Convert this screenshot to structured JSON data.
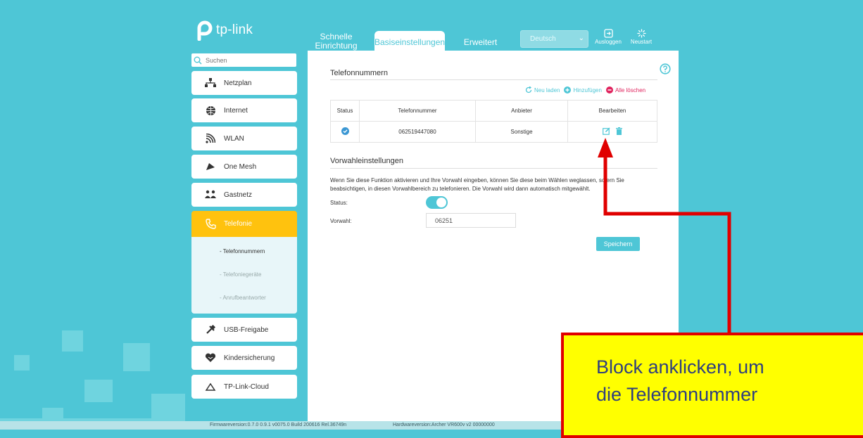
{
  "brand": {
    "name": "tp-link"
  },
  "colors": {
    "accent": "#4ec6d6",
    "active_nav": "#ffc20e",
    "background": "#4ec6d6",
    "callout_bg": "#ffff00",
    "callout_border": "#e00000"
  },
  "top_tabs": [
    {
      "line1": "Schnelle",
      "line2": "Einrichtung"
    },
    {
      "label": "Basiseinstellungen"
    },
    {
      "label": "Erweitert"
    }
  ],
  "language": {
    "selected": "Deutsch"
  },
  "top_buttons": {
    "logout": "Ausloggen",
    "restart": "Neustart"
  },
  "search": {
    "placeholder": "Suchen"
  },
  "sidebar": {
    "items": [
      {
        "label": "Netzplan",
        "icon": "network-map-icon"
      },
      {
        "label": "Internet",
        "icon": "globe-icon"
      },
      {
        "label": "WLAN",
        "icon": "wifi-icon"
      },
      {
        "label": "One Mesh",
        "icon": "mesh-icon"
      },
      {
        "label": "Gastnetz",
        "icon": "guest-network-icon"
      },
      {
        "label": "Telefonie",
        "icon": "telephone-icon"
      },
      {
        "label": "USB-Freigabe",
        "icon": "usb-icon"
      },
      {
        "label": "Kindersicherung",
        "icon": "heart-shield-icon"
      },
      {
        "label": "TP-Link-Cloud",
        "icon": "cloud-icon"
      }
    ],
    "sub_items": [
      "- Telefonnummern",
      "- Telefoniegeräte",
      "- Anrufbeantworter"
    ]
  },
  "phone_section": {
    "title": "Telefonnummern",
    "actions": {
      "reload": "Neu laden",
      "add": "Hinzufügen",
      "delete_all": "Alle löschen"
    },
    "columns": [
      "Status",
      "Telefonnummer",
      "Anbieter",
      "Bearbeiten"
    ],
    "rows": [
      {
        "number": "062519447080",
        "provider": "Sonstige"
      }
    ]
  },
  "prefix_section": {
    "title": "Vorwahleinstellungen",
    "description": "Wenn Sie diese Funktion aktivieren und Ihre Vorwahl eingeben, können Sie diese beim Wählen weglassen, sofern Sie beabsichtigen, in diesen Vorwahlbereich zu telefonieren. Die Vorwahl wird dann automatisch mitgewählt.",
    "status_label": "Status:",
    "status_enabled": true,
    "prefix_label": "Vorwahl:",
    "prefix_value": "06251",
    "save_label": "Speichern"
  },
  "footer": {
    "firmware": "Firmwareversion:0.7.0 0.9.1 v0075.0 Build 200616 Rel.36749n",
    "hardware": "Hardwareversion:Archer VR600v v2 00000000"
  },
  "callout": {
    "line1": "Block anklicken, um",
    "line2": "die Telefonnummer"
  }
}
